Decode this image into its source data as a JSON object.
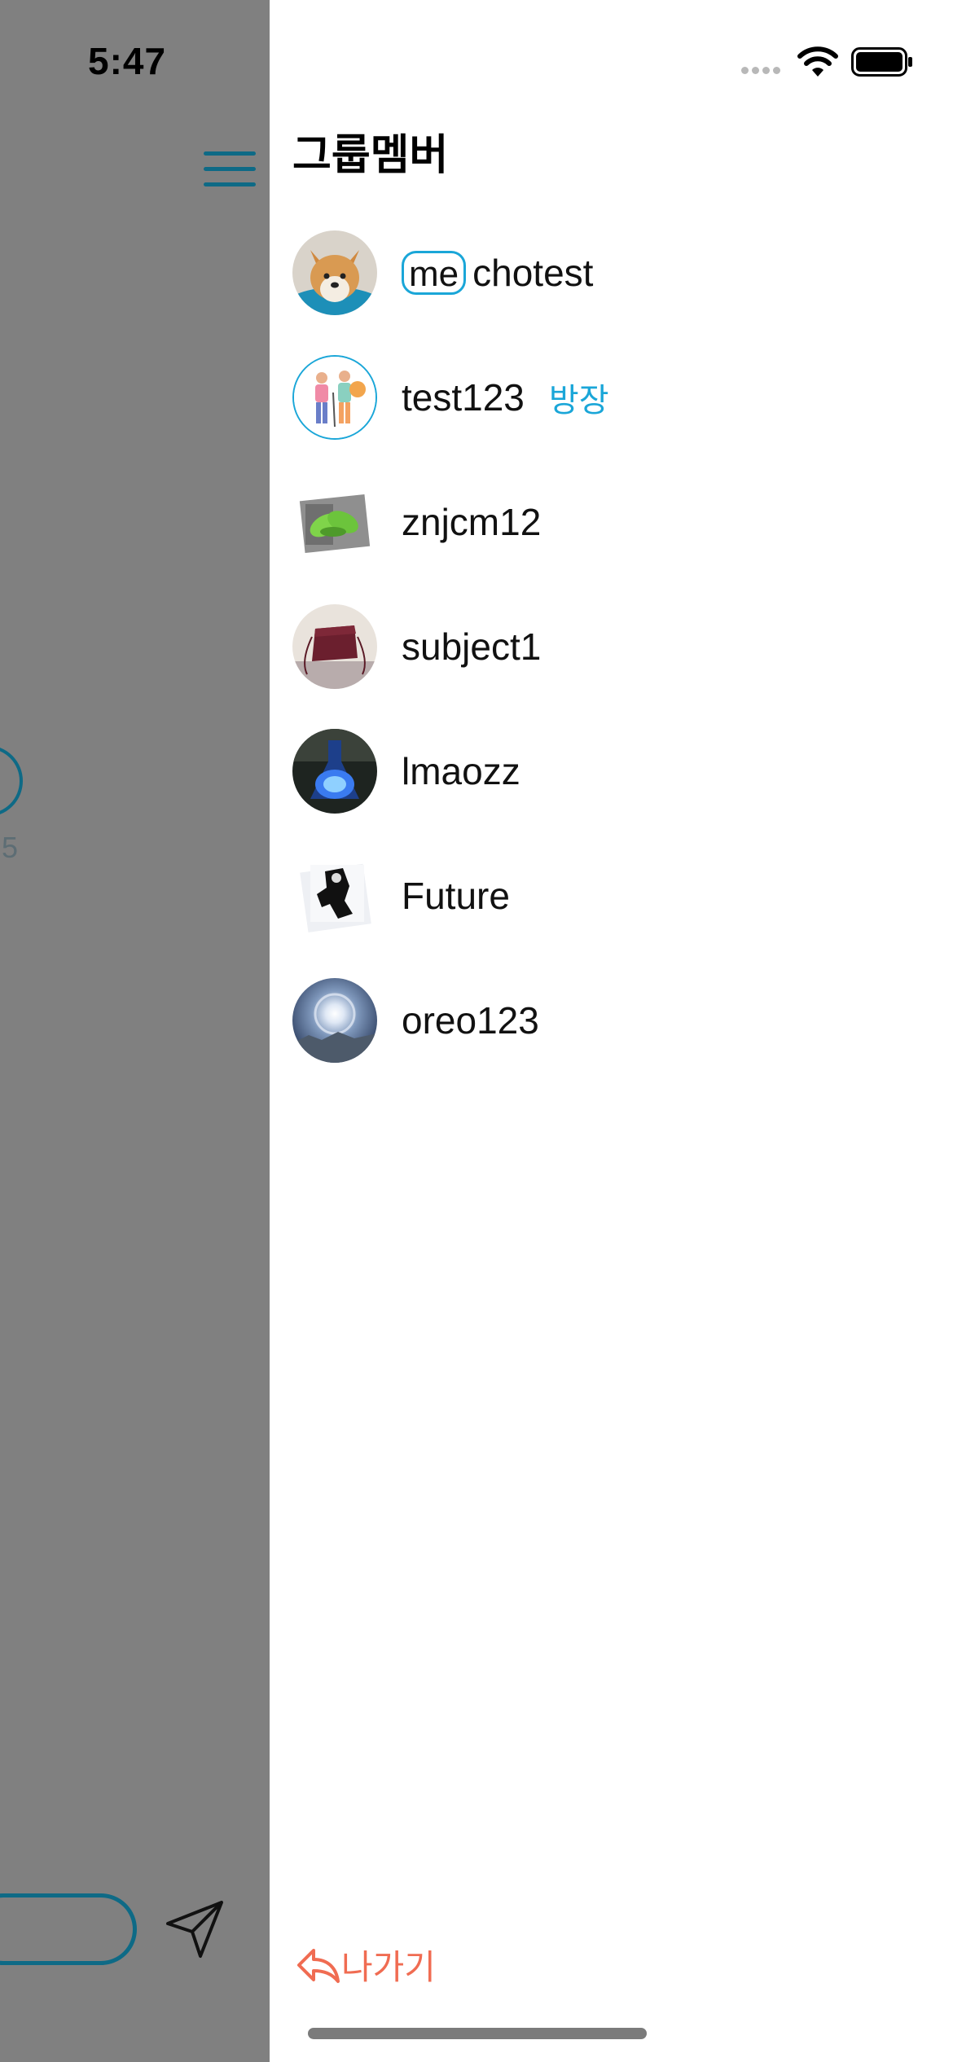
{
  "status_bar": {
    "time": "5:47"
  },
  "drawer": {
    "title": "그룹멤버",
    "members": [
      {
        "name": "chotest",
        "me_label": "me",
        "avatar": "shiba-dog-photo"
      },
      {
        "name": "test123",
        "owner_label": "방장",
        "avatar": "couple-illustration"
      },
      {
        "name": "znjcm12",
        "avatar": "green-shoes-photo"
      },
      {
        "name": "subject1",
        "avatar": "burgundy-bag-photo"
      },
      {
        "name": "lmaozz",
        "avatar": "blue-glowing-flask-photo"
      },
      {
        "name": "Future",
        "avatar": "black-white-figure-photo"
      },
      {
        "name": "oreo123",
        "avatar": "sun-halo-sky-photo"
      }
    ],
    "leave_label": "나가기"
  },
  "background": {
    "count_fragment": "5"
  },
  "colors": {
    "accent": "#1aa6d8",
    "teal": "#0e6a86",
    "leave": "#f06c52",
    "overlay": "#808080"
  }
}
